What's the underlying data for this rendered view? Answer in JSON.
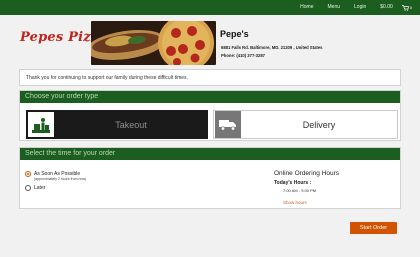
{
  "nav": {
    "home": "Home",
    "menu": "Menu",
    "login": "Login",
    "cart_total": "$0.00",
    "cart_count": "0"
  },
  "header": {
    "logo_text": "Pepes Pizza",
    "restaurant_name": "Pepe's",
    "address": "6881 Falls Rd. Baltimore, MD. 21209 , United States",
    "phone": "Phone: (410) 377-3287"
  },
  "notice": {
    "text": "Thank you for continuing to support our family during these difficult times."
  },
  "order_type": {
    "heading": "Choose your order type",
    "takeout_label": "Takeout",
    "delivery_label": "Delivery"
  },
  "time_select": {
    "heading": "Select the time for your order",
    "asap_label": "As Soon As Possible",
    "asap_note": "(approximately 2 hours from now)",
    "later_label": "Later",
    "selected": "asap"
  },
  "hours": {
    "title": "Online Ordering Hours",
    "today_label": "Today's Hours :",
    "today_time": "7:00 AM - 9:00 PM",
    "show_hours": "Show hours"
  },
  "start_button": "Start Order",
  "colors": {
    "top_bar": "#1b5e20",
    "accent": "#d35400",
    "logo": "#c0241c"
  }
}
